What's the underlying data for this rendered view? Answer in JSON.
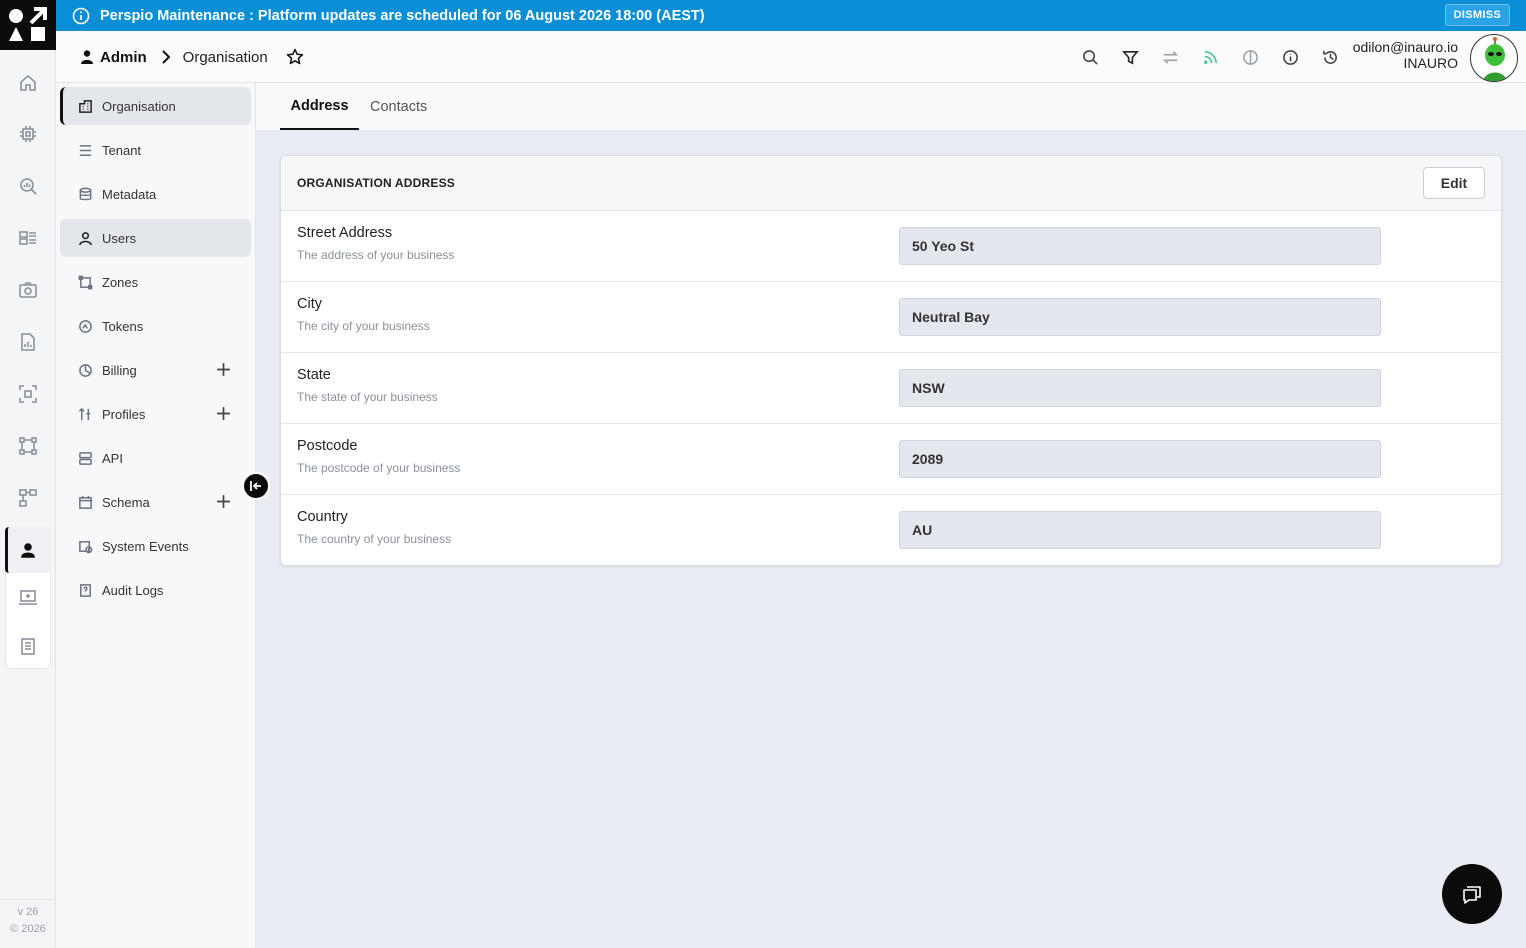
{
  "banner": {
    "text": "Perspio Maintenance : Platform updates are scheduled for 06 August 2026 18:00 (AEST)",
    "dismiss_label": "DISMISS",
    "color": "#0a8fd6"
  },
  "rail": {
    "icons": [
      "home-icon",
      "chip-icon",
      "search-chart-icon",
      "dashboard-icon",
      "camera-icon",
      "report-icon",
      "scan-icon",
      "zones-icon",
      "hierarchy-icon",
      "admin-icon",
      "device-icon",
      "clipboard-icon"
    ],
    "version": "v 26",
    "copyright": "© 2026"
  },
  "header": {
    "breadcrumb_root": "Admin",
    "breadcrumb_page": "Organisation",
    "user_email": "odilon@inauro.io",
    "user_org": "INAURO"
  },
  "subnav": {
    "items": [
      {
        "label": "Organisation",
        "icon": "organisation-icon"
      },
      {
        "label": "Tenant",
        "icon": "tenant-icon"
      },
      {
        "label": "Metadata",
        "icon": "database-icon"
      },
      {
        "label": "Users",
        "icon": "user-icon"
      },
      {
        "label": "Zones",
        "icon": "zones-icon"
      },
      {
        "label": "Tokens",
        "icon": "tokens-icon"
      },
      {
        "label": "Billing",
        "icon": "billing-icon"
      },
      {
        "label": "Profiles",
        "icon": "profiles-icon"
      },
      {
        "label": "API",
        "icon": "api-icon"
      },
      {
        "label": "Schema",
        "icon": "calendar-icon"
      },
      {
        "label": "System Events",
        "icon": "system-events-icon"
      },
      {
        "label": "Audit Logs",
        "icon": "audit-icon"
      }
    ]
  },
  "tabs": [
    {
      "label": "Address"
    },
    {
      "label": "Contacts"
    }
  ],
  "card": {
    "title": "ORGANISATION ADDRESS",
    "edit_label": "Edit",
    "rows": [
      {
        "label": "Street Address",
        "help": "The address of your business",
        "value": "50 Yeo St"
      },
      {
        "label": "City",
        "help": "The city of your business",
        "value": "Neutral Bay"
      },
      {
        "label": "State",
        "help": "The state of your business",
        "value": "NSW"
      },
      {
        "label": "Postcode",
        "help": "The postcode of your business",
        "value": "2089"
      },
      {
        "label": "Country",
        "help": "The country of your business",
        "value": "AU"
      }
    ]
  }
}
